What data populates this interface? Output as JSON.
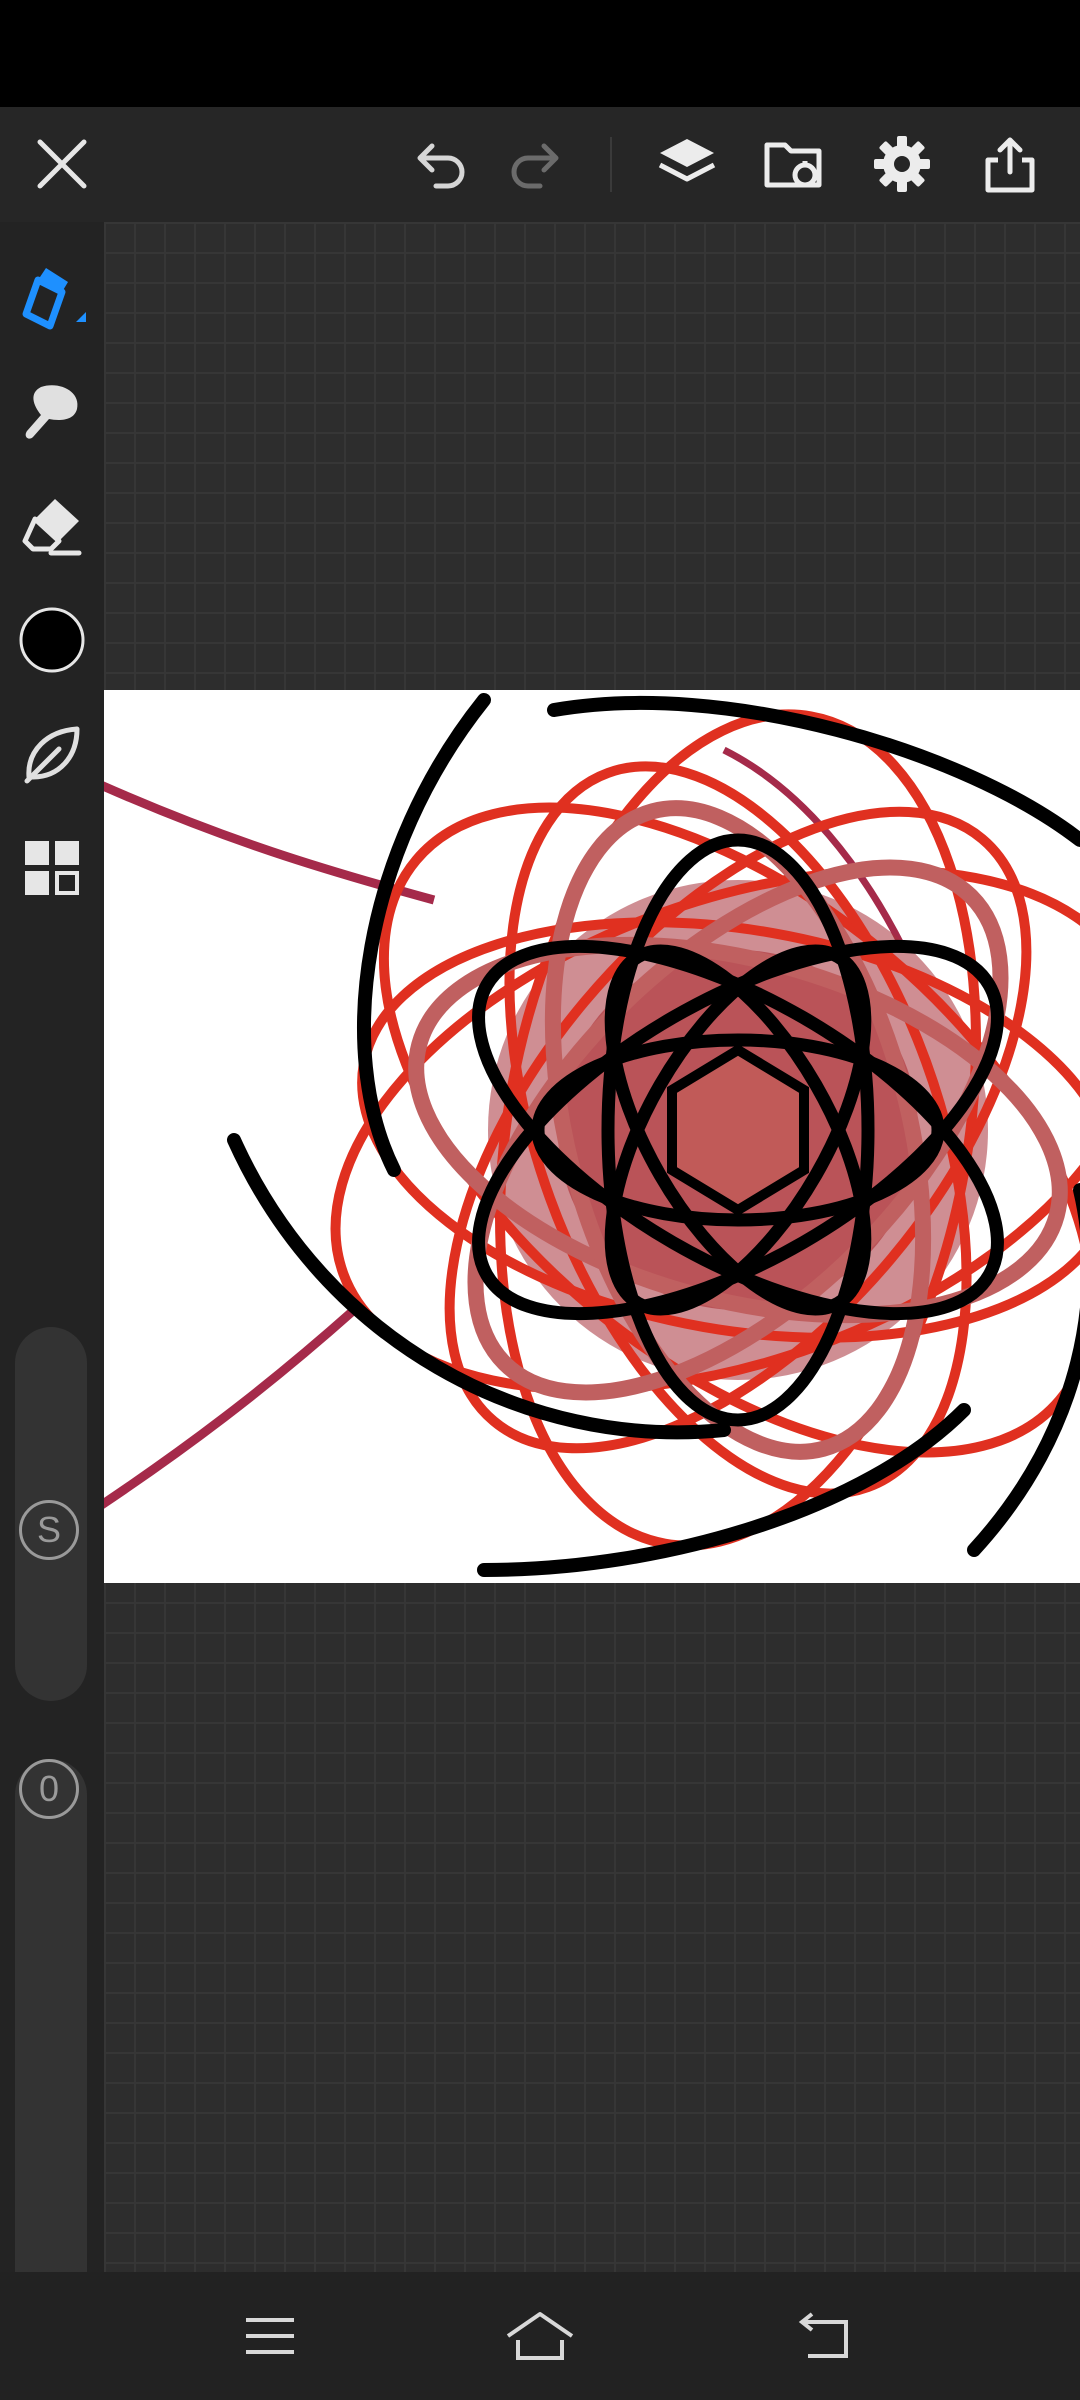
{
  "topbar": {
    "close": {
      "icon": "close-icon"
    },
    "undo": {
      "icon": "undo-icon"
    },
    "redo": {
      "icon": "redo-icon"
    },
    "layers": {
      "icon": "layers-icon"
    },
    "import": {
      "icon": "folder-import-icon"
    },
    "settings": {
      "icon": "gear-icon"
    },
    "share": {
      "icon": "share-icon"
    }
  },
  "tools": {
    "pen": {
      "icon": "pen-icon",
      "active": true,
      "accent": "#1e90ff"
    },
    "smudge": {
      "icon": "smudge-icon"
    },
    "eraser": {
      "icon": "eraser-icon"
    },
    "color": {
      "icon": "color-swatch",
      "value": "#000000"
    },
    "brush_library": {
      "icon": "leaf-icon"
    },
    "grid": {
      "icon": "grid-icon"
    }
  },
  "size_slider": {
    "label": "S"
  },
  "opacity_slider": {
    "label": "0"
  },
  "navbar": {
    "menu": {
      "icon": "menu-icon"
    },
    "home": {
      "icon": "home-icon"
    },
    "back": {
      "icon": "back-icon"
    }
  }
}
